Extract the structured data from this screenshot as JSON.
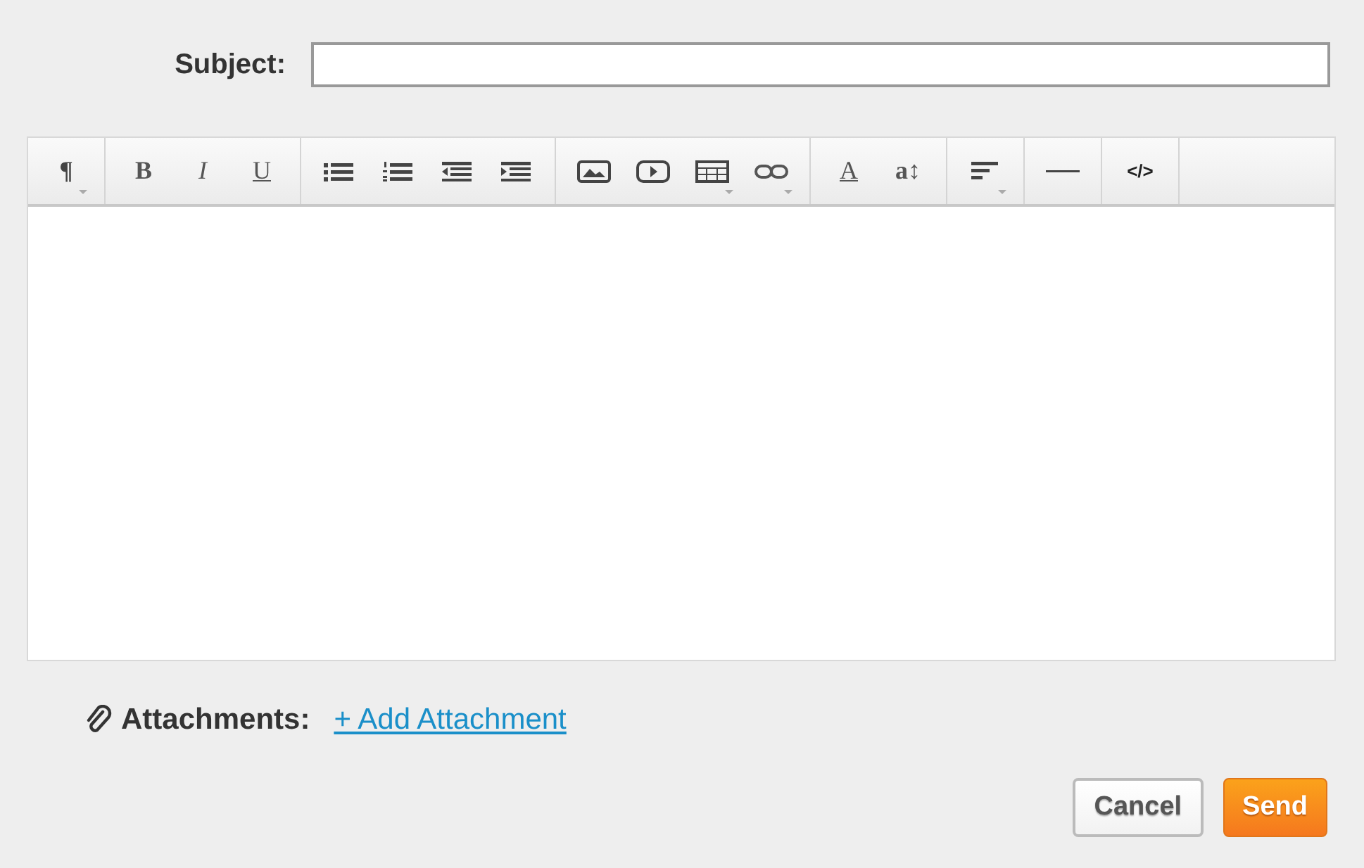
{
  "subject": {
    "label": "Subject:"
  },
  "toolbar": [
    [
      {
        "kind": "paragraph",
        "glyph": "¶",
        "has_menu": true
      }
    ],
    [
      {
        "kind": "bold",
        "glyph": "B",
        "has_menu": false
      },
      {
        "kind": "italic",
        "glyph": "I",
        "has_menu": false
      },
      {
        "kind": "underline",
        "glyph": "U",
        "has_menu": false
      }
    ],
    [
      {
        "kind": "bullet-list",
        "has_menu": false
      },
      {
        "kind": "numbered-list",
        "has_menu": false
      },
      {
        "kind": "outdent",
        "has_menu": false
      },
      {
        "kind": "indent",
        "has_menu": false
      }
    ],
    [
      {
        "kind": "image",
        "has_menu": false
      },
      {
        "kind": "video",
        "has_menu": false
      },
      {
        "kind": "table",
        "has_menu": true
      },
      {
        "kind": "link",
        "has_menu": true
      }
    ],
    [
      {
        "kind": "font-color",
        "glyph": "A",
        "has_menu": false
      },
      {
        "kind": "font-size",
        "glyph": "a↕",
        "has_menu": false
      }
    ],
    [
      {
        "kind": "align",
        "has_menu": true
      }
    ],
    [
      {
        "kind": "rule",
        "has_menu": false
      }
    ],
    [
      {
        "kind": "code",
        "glyph": "</>",
        "has_menu": false
      }
    ]
  ],
  "attachments": {
    "label": "Attachments:",
    "link": "+ Add Attachment"
  },
  "buttons": [
    {
      "label": "Cancel",
      "kind": "secondary"
    },
    {
      "label": "Send",
      "kind": "primary"
    }
  ]
}
